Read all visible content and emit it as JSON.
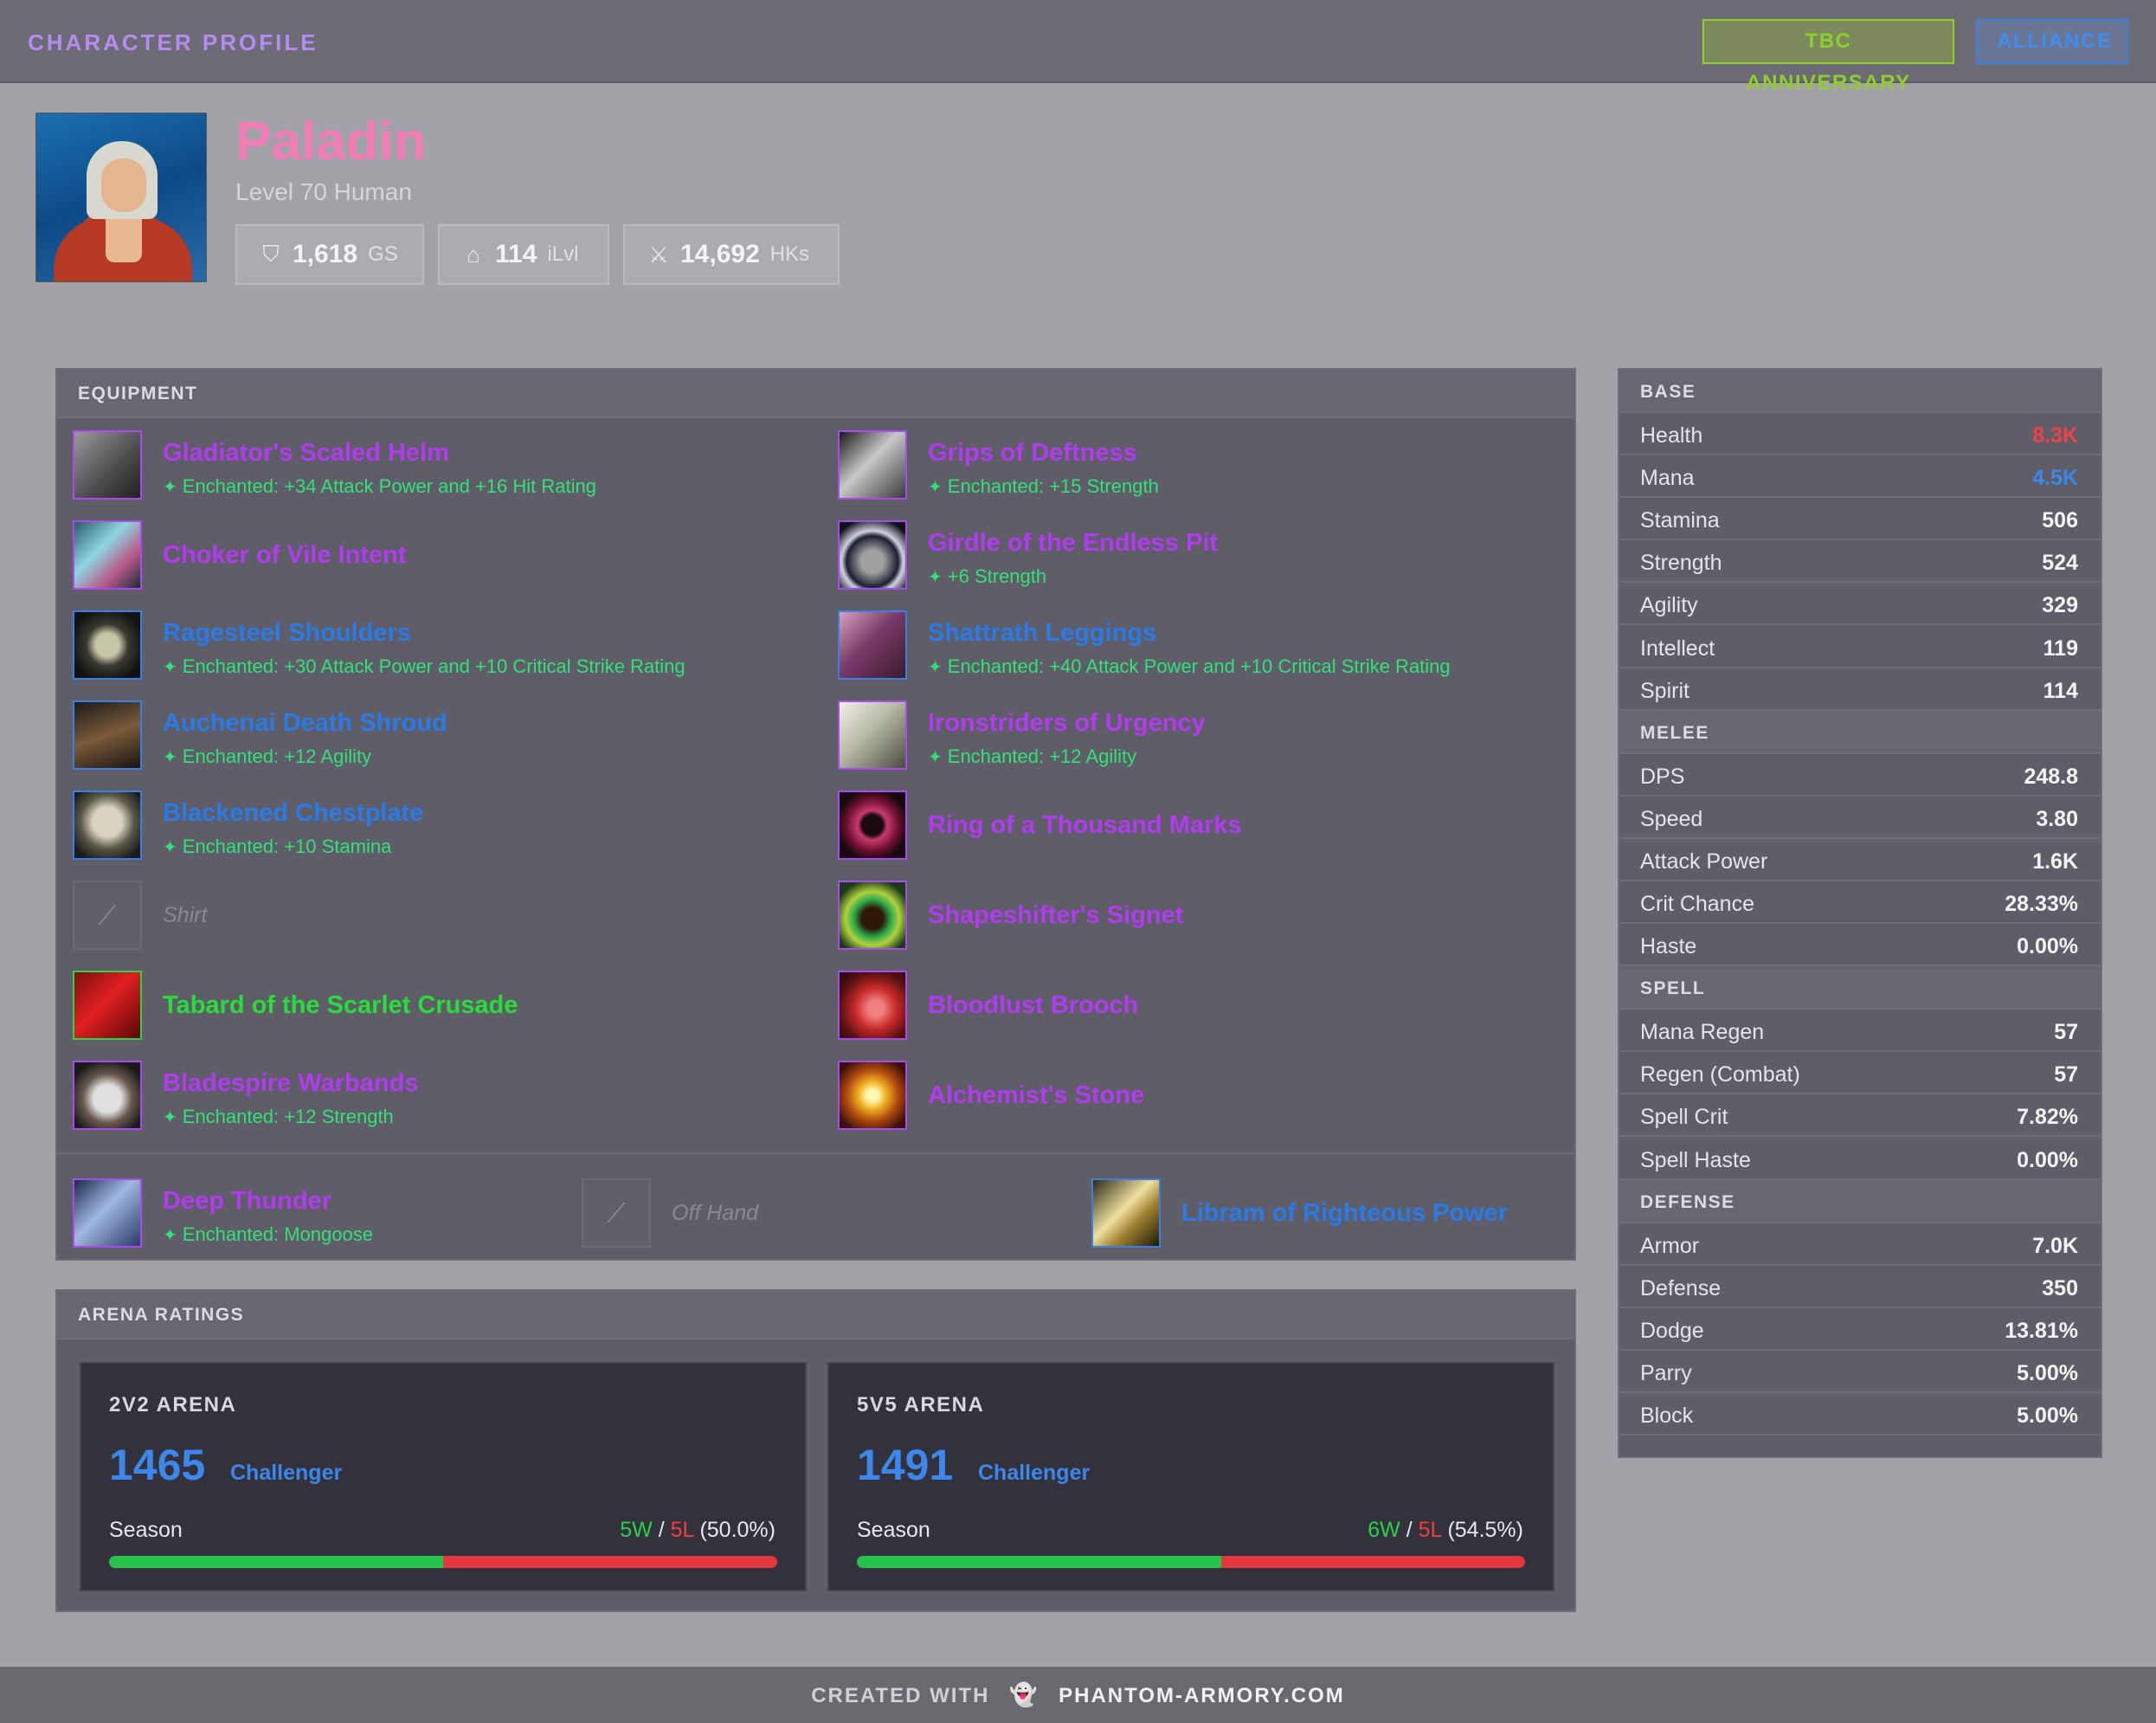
{
  "header": {
    "title": "CHARACTER PROFILE",
    "badges": {
      "tbc": "TBC ANNIVERSARY",
      "faction": "ALLIANCE"
    }
  },
  "profile": {
    "name": "Paladin",
    "subtitle": "Level 70 Human",
    "stats": {
      "gs": {
        "value": "1,618",
        "unit": "GS"
      },
      "ilvl": {
        "value": "114",
        "unit": "iLvl"
      },
      "hks": {
        "value": "14,692",
        "unit": "HKs"
      }
    }
  },
  "equipment": {
    "title": "EQUIPMENT",
    "left": [
      {
        "name": "Gladiator's Scaled Helm",
        "ench": "Enchanted: +34 Attack Power and +16 Hit Rating"
      },
      {
        "name": "Choker of Vile Intent",
        "ench": ""
      },
      {
        "name": "Ragesteel Shoulders",
        "ench": "Enchanted: +30 Attack Power and +10 Critical Strike Rating"
      },
      {
        "name": "Auchenai Death Shroud",
        "ench": "Enchanted: +12 Agility"
      },
      {
        "name": "Blackened Chestplate",
        "ench": "Enchanted: +10 Stamina"
      },
      {
        "name": "Shirt",
        "ench": ""
      },
      {
        "name": "Tabard of the Scarlet Crusade",
        "ench": ""
      },
      {
        "name": "Bladespire Warbands",
        "ench": "Enchanted: +12 Strength"
      }
    ],
    "right": [
      {
        "name": "Grips of Deftness",
        "ench": "Enchanted: +15 Strength"
      },
      {
        "name": "Girdle of the Endless Pit",
        "ench": "+6 Strength"
      },
      {
        "name": "Shattrath Leggings",
        "ench": "Enchanted: +40 Attack Power and +10 Critical Strike Rating"
      },
      {
        "name": "Ironstriders of Urgency",
        "ench": "Enchanted: +12 Agility"
      },
      {
        "name": "Ring of a Thousand Marks",
        "ench": ""
      },
      {
        "name": "Shapeshifter's Signet",
        "ench": ""
      },
      {
        "name": "Bloodlust Brooch",
        "ench": ""
      },
      {
        "name": "Alchemist's Stone",
        "ench": ""
      }
    ],
    "weapons": {
      "main": {
        "name": "Deep Thunder",
        "ench": "Enchanted: Mongoose"
      },
      "off": {
        "name": "Off Hand"
      },
      "relic": {
        "name": "Libram of Righteous Power"
      }
    }
  },
  "arena": {
    "title": "ARENA RATINGS",
    "cards": [
      {
        "title": "2V2 ARENA",
        "rating": "1465",
        "rank": "Challenger",
        "season": "Season",
        "wins": "5W",
        "losses": "5L",
        "pct": "(50.0%)",
        "win_fraction": 0.5
      },
      {
        "title": "5V5 ARENA",
        "rating": "1491",
        "rank": "Challenger",
        "season": "Season",
        "wins": "6W",
        "losses": "5L",
        "pct": "(54.5%)",
        "win_fraction": 0.545
      }
    ]
  },
  "stats": {
    "base": {
      "title": "BASE",
      "rows": [
        [
          "Health",
          "8.3K"
        ],
        [
          "Mana",
          "4.5K"
        ],
        [
          "Stamina",
          "506"
        ],
        [
          "Strength",
          "524"
        ],
        [
          "Agility",
          "329"
        ],
        [
          "Intellect",
          "119"
        ],
        [
          "Spirit",
          "114"
        ]
      ]
    },
    "melee": {
      "title": "MELEE",
      "rows": [
        [
          "DPS",
          "248.8"
        ],
        [
          "Speed",
          "3.80"
        ],
        [
          "Attack Power",
          "1.6K"
        ],
        [
          "Crit Chance",
          "28.33%"
        ],
        [
          "Haste",
          "0.00%"
        ]
      ]
    },
    "spell": {
      "title": "SPELL",
      "rows": [
        [
          "Mana Regen",
          "57"
        ],
        [
          "Regen (Combat)",
          "57"
        ],
        [
          "Spell Crit",
          "7.82%"
        ],
        [
          "Spell Haste",
          "0.00%"
        ]
      ]
    },
    "defense": {
      "title": "DEFENSE",
      "rows": [
        [
          "Armor",
          "7.0K"
        ],
        [
          "Defense",
          "350"
        ],
        [
          "Dodge",
          "13.81%"
        ],
        [
          "Parry",
          "5.00%"
        ],
        [
          "Block",
          "5.00%"
        ]
      ]
    }
  },
  "footer": {
    "prefix": "CREATED WITH",
    "brand": "PHANTOM-ARMORY.COM"
  },
  "colors": {
    "epic": "#b13bf0",
    "rare": "#2a7ae8",
    "uncommon": "#28dc3c",
    "health": "#f0404a",
    "mana": "#3d86ea",
    "enchant": "#33e07a"
  }
}
